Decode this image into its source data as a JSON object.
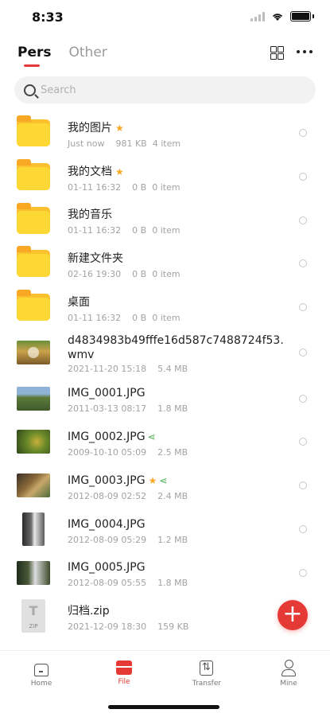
{
  "status": {
    "time": "8:33"
  },
  "tabs": [
    {
      "label": "Pers",
      "active": true
    },
    {
      "label": "Other",
      "active": false
    }
  ],
  "search": {
    "placeholder": "Search"
  },
  "items": [
    {
      "name": "我的图片",
      "date": "Just now",
      "size": "981 KB",
      "count": "4 item",
      "type": "folder",
      "starred": true
    },
    {
      "name": "我的文档",
      "date": "01-11 16:32",
      "size": "0 B",
      "count": "0 item",
      "type": "folder",
      "starred": true
    },
    {
      "name": "我的音乐",
      "date": "01-11 16:32",
      "size": "0 B",
      "count": "0 item",
      "type": "folder"
    },
    {
      "name": "新建文件夹",
      "date": "02-16 19:30",
      "size": "0 B",
      "count": "0 item",
      "type": "folder"
    },
    {
      "name": "桌面",
      "date": "01-11 16:32",
      "size": "0 B",
      "count": "0 item",
      "type": "folder"
    },
    {
      "name": "d4834983b49fffe16d587c7488724f53.",
      "name2": "wmv",
      "date": "2021-11-20 15:18",
      "size": "5.4 MB",
      "type": "video"
    },
    {
      "name": "IMG_0001.JPG",
      "date": "2011-03-13 08:17",
      "size": "1.8 MB",
      "type": "photo"
    },
    {
      "name": "IMG_0002.JPG",
      "date": "2009-10-10 05:09",
      "size": "2.5 MB",
      "type": "photo",
      "shared": true
    },
    {
      "name": "IMG_0003.JPG",
      "date": "2012-08-09 02:52",
      "size": "2.4 MB",
      "type": "photo",
      "starred": true,
      "shared": true
    },
    {
      "name": "IMG_0004.JPG",
      "date": "2012-08-09 05:29",
      "size": "1.2 MB",
      "type": "photo-portrait"
    },
    {
      "name": "IMG_0005.JPG",
      "date": "2012-08-09 05:55",
      "size": "1.8 MB",
      "type": "photo"
    },
    {
      "name": "归档.zip",
      "date": "2021-12-09 18:30",
      "size": "159 KB",
      "type": "zip"
    }
  ],
  "zip_icon_label": "ZIP",
  "fab": {
    "symbol": "+"
  },
  "tabbar": [
    {
      "label": "Home"
    },
    {
      "label": "File",
      "active": true
    },
    {
      "label": "Transfer"
    },
    {
      "label": "Mine"
    }
  ],
  "colors": {
    "accent": "#e53935",
    "folder": "#fdd835",
    "star": "#f9a825",
    "share": "#4caf50"
  },
  "icons": {
    "star": "★",
    "share": "share-icon"
  }
}
